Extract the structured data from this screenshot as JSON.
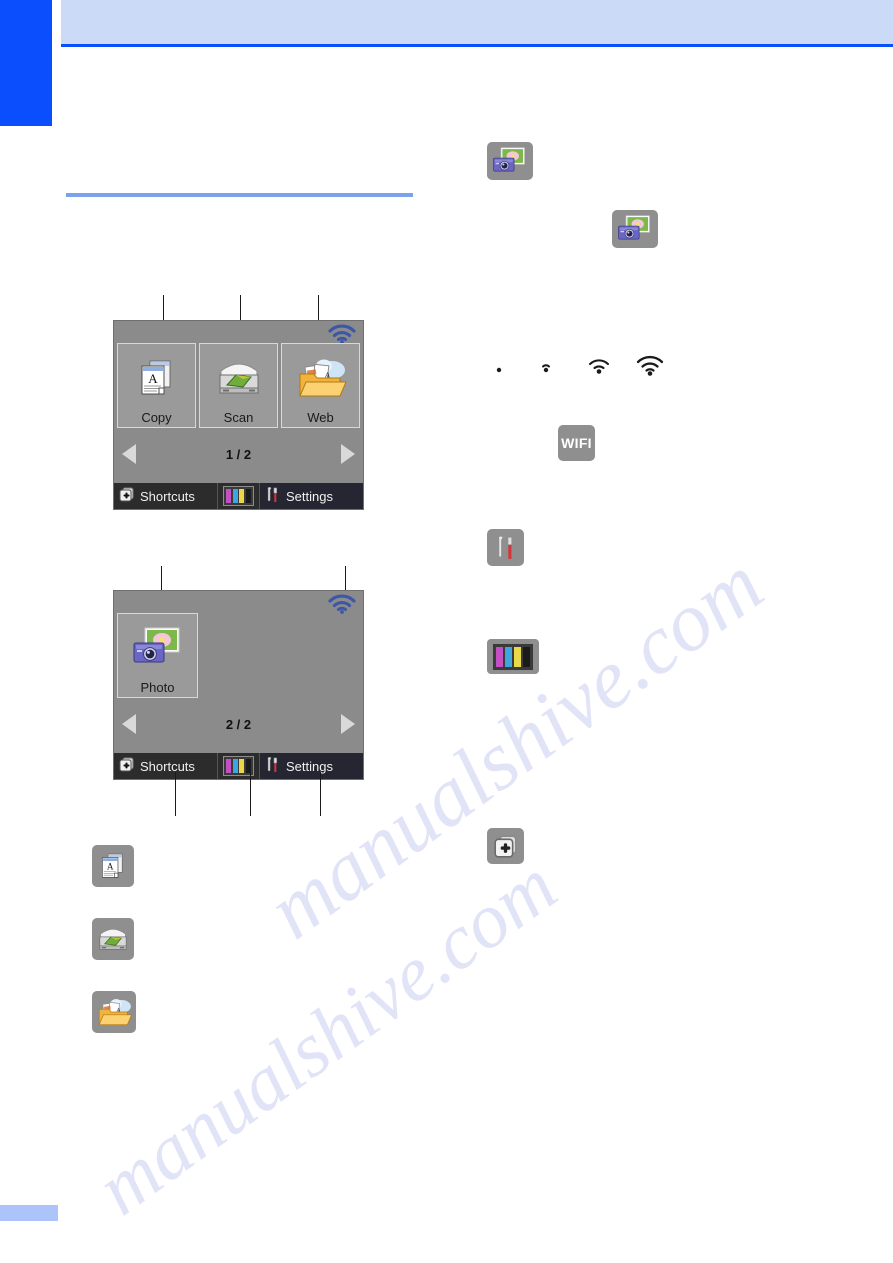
{
  "page": {
    "accent_blue": "#0a4efe",
    "band_blue": "#cbdbf7",
    "rule_blue": "#7ba2f0",
    "watermark_text": "manualshive.com"
  },
  "screens": [
    {
      "name": "home-screen-page-1",
      "page_indicator": "1 / 2",
      "wifi_level": 3,
      "tiles": [
        {
          "label": "Copy",
          "icon": "copy-icon"
        },
        {
          "label": "Scan",
          "icon": "scan-icon"
        },
        {
          "label": "Web",
          "icon": "web-icon"
        }
      ],
      "bottom_bar": {
        "shortcuts_label": "Shortcuts",
        "shortcuts_icon": "shortcuts-icon",
        "ink_icon": "ink-level-icon",
        "settings_label": "Settings",
        "settings_icon": "settings-tools-icon"
      },
      "prev_arrow": "left-triangle-icon",
      "next_arrow": "right-triangle-icon",
      "callouts": [
        {
          "target": "Copy"
        },
        {
          "target": "Scan"
        },
        {
          "target": "Web"
        }
      ]
    },
    {
      "name": "home-screen-page-2",
      "page_indicator": "2 / 2",
      "wifi_level": 3,
      "tiles": [
        {
          "label": "Photo",
          "icon": "photo-icon"
        }
      ],
      "bottom_bar": {
        "shortcuts_label": "Shortcuts",
        "shortcuts_icon": "shortcuts-icon",
        "ink_icon": "ink-level-icon",
        "settings_label": "Settings",
        "settings_icon": "settings-tools-icon"
      },
      "prev_arrow": "left-triangle-icon",
      "next_arrow": "right-triangle-icon",
      "callouts": [
        {
          "target": "Photo"
        },
        {
          "target": "wifi-status"
        },
        {
          "target": "Shortcuts"
        },
        {
          "target": "ink"
        },
        {
          "target": "Settings"
        }
      ]
    }
  ],
  "legend_left": [
    {
      "icon": "copy-icon"
    },
    {
      "icon": "scan-icon"
    },
    {
      "icon": "web-icon"
    }
  ],
  "legend_right": [
    {
      "icon": "photo-icon",
      "size": "large"
    },
    {
      "icon": "photo-icon",
      "size": "small"
    },
    {
      "icon": "wifi-strength-row",
      "levels": [
        0,
        1,
        2,
        3
      ]
    },
    {
      "icon": "wifi-button",
      "label": "WIFI"
    },
    {
      "icon": "settings-tools-icon"
    },
    {
      "icon": "ink-level-icon"
    },
    {
      "icon": "shortcuts-icon"
    }
  ],
  "ink_colors": [
    "#c44ec4",
    "#3ea6dd",
    "#e8d84a",
    "#1b1b1b"
  ]
}
